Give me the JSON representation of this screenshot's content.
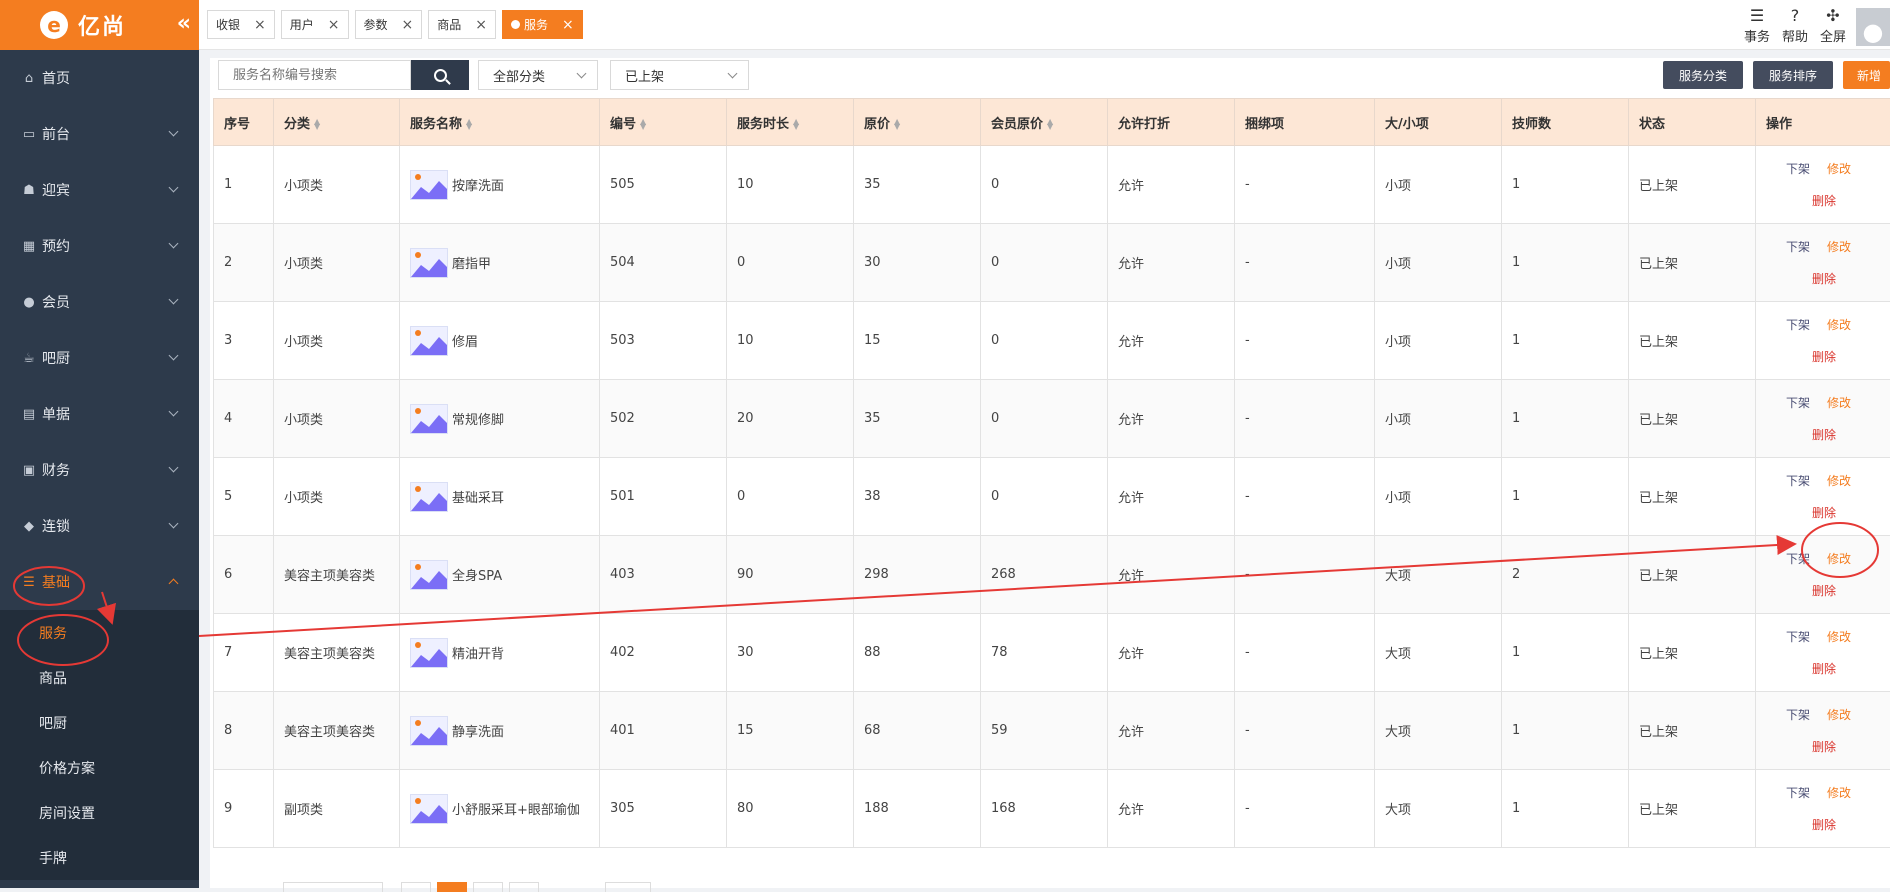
{
  "app": {
    "logo_letter": "e",
    "name": "亿尚"
  },
  "sidebar": {
    "items": [
      {
        "label": "首页",
        "icon": "home-icon",
        "glyph": "⌂",
        "chevron": false
      },
      {
        "label": "前台",
        "icon": "monitor-icon",
        "glyph": "▭",
        "chevron": true
      },
      {
        "label": "迎宾",
        "icon": "reception-icon",
        "glyph": "☗",
        "chevron": true
      },
      {
        "label": "预约",
        "icon": "calendar-icon",
        "glyph": "▦",
        "chevron": true
      },
      {
        "label": "会员",
        "icon": "user-icon",
        "glyph": "●",
        "chevron": true
      },
      {
        "label": "吧厨",
        "icon": "cup-icon",
        "glyph": "☕",
        "chevron": true
      },
      {
        "label": "单据",
        "icon": "clipboard-icon",
        "glyph": "▤",
        "chevron": true
      },
      {
        "label": "财务",
        "icon": "money-icon",
        "glyph": "▣",
        "chevron": true
      },
      {
        "label": "连锁",
        "icon": "cube-icon",
        "glyph": "◆",
        "chevron": true
      },
      {
        "label": "基础",
        "icon": "list-icon",
        "glyph": "☰",
        "chevron": true,
        "active": true
      }
    ],
    "sub_items": [
      "服务",
      "商品",
      "吧厨",
      "价格方案",
      "房间设置",
      "手牌"
    ]
  },
  "tabs": [
    {
      "label": "收银"
    },
    {
      "label": "用户"
    },
    {
      "label": "参数"
    },
    {
      "label": "商品"
    },
    {
      "label": "服务",
      "active": true
    }
  ],
  "top_actions": [
    {
      "label": "事务",
      "icon": "menu-icon",
      "glyph": "☰"
    },
    {
      "label": "帮助",
      "icon": "help-icon",
      "glyph": "?"
    },
    {
      "label": "全屏",
      "icon": "fullscreen-icon",
      "glyph": "✣"
    }
  ],
  "toolbar": {
    "search_placeholder": "服务名称编号搜索",
    "category_select": "全部分类",
    "status_select": "已上架",
    "btn_category": "服务分类",
    "btn_sort": "服务排序",
    "btn_add": "新增"
  },
  "table": {
    "headers": [
      "序号",
      "分类",
      "服务名称",
      "编号",
      "服务时长",
      "原价",
      "会员原价",
      "允许打折",
      "捆绑项",
      "大/小项",
      "技师数",
      "状态",
      "操作"
    ],
    "sortable": [
      false,
      true,
      true,
      true,
      true,
      true,
      true,
      false,
      false,
      false,
      false,
      false,
      false
    ],
    "rows": [
      [
        "1",
        "小项类",
        "按摩洗面",
        "505",
        "10",
        "35",
        "0",
        "允许",
        "-",
        "小项",
        "1",
        "已上架"
      ],
      [
        "2",
        "小项类",
        "磨指甲",
        "504",
        "0",
        "30",
        "0",
        "允许",
        "-",
        "小项",
        "1",
        "已上架"
      ],
      [
        "3",
        "小项类",
        "修眉",
        "503",
        "10",
        "15",
        "0",
        "允许",
        "-",
        "小项",
        "1",
        "已上架"
      ],
      [
        "4",
        "小项类",
        "常规修脚",
        "502",
        "20",
        "35",
        "0",
        "允许",
        "-",
        "小项",
        "1",
        "已上架"
      ],
      [
        "5",
        "小项类",
        "基础采耳",
        "501",
        "0",
        "38",
        "0",
        "允许",
        "-",
        "小项",
        "1",
        "已上架"
      ],
      [
        "6",
        "美容主项美容类",
        "全身SPA",
        "403",
        "90",
        "298",
        "268",
        "允许",
        "-",
        "大项",
        "2",
        "已上架"
      ],
      [
        "7",
        "美容主项美容类",
        "精油开背",
        "402",
        "30",
        "88",
        "78",
        "允许",
        "-",
        "大项",
        "1",
        "已上架"
      ],
      [
        "8",
        "美容主项美容类",
        "静享洗面",
        "401",
        "15",
        "68",
        "59",
        "允许",
        "-",
        "大项",
        "1",
        "已上架"
      ],
      [
        "9",
        "副项类",
        "小舒服采耳+眼部瑜伽",
        "305",
        "80",
        "188",
        "168",
        "允许",
        "-",
        "大项",
        "1",
        "已上架"
      ]
    ],
    "ops": {
      "down": "下架",
      "edit": "修改",
      "delete": "删除"
    }
  },
  "colors": {
    "accent": "#f47d20",
    "sidebar": "#2d3a4b",
    "annotation": "#e53935"
  }
}
